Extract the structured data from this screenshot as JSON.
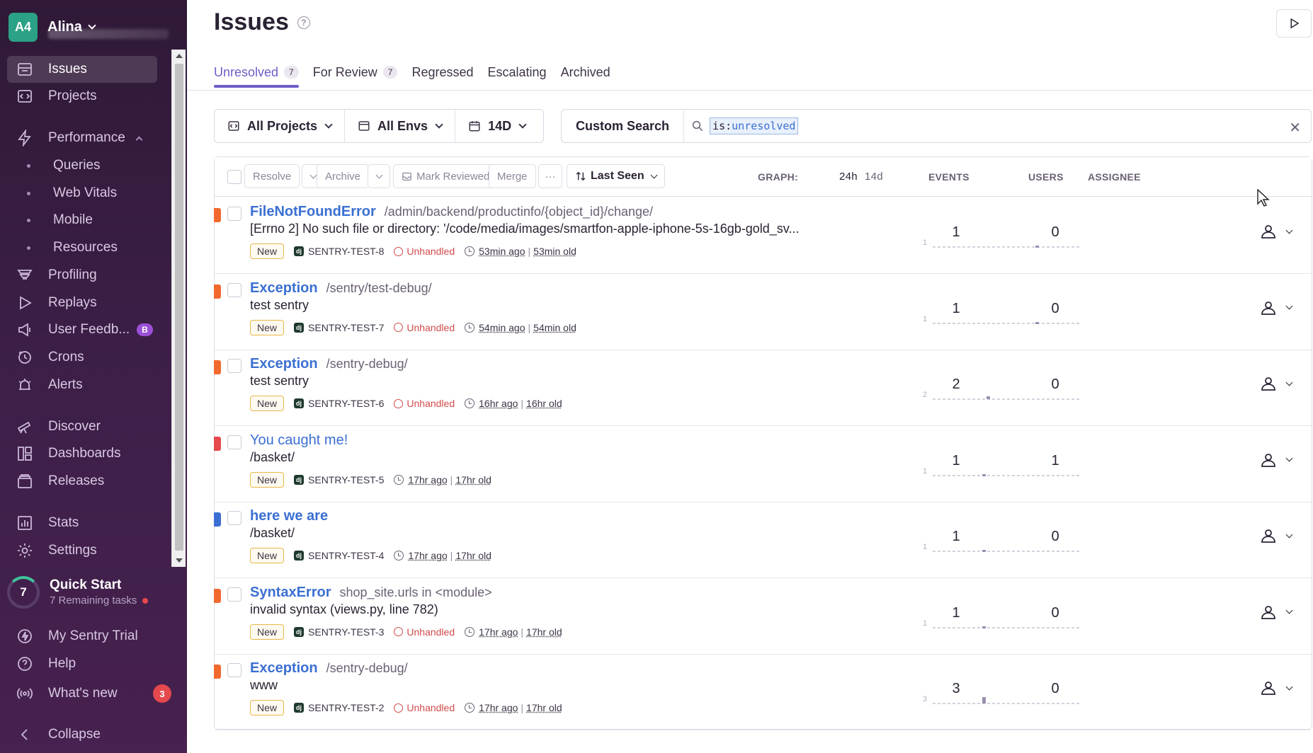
{
  "org": {
    "avatar": "A4",
    "name": "Alina"
  },
  "nav": {
    "issues": "Issues",
    "projects": "Projects",
    "performance": "Performance",
    "queries": "Queries",
    "web_vitals": "Web Vitals",
    "mobile": "Mobile",
    "resources": "Resources",
    "profiling": "Profiling",
    "replays": "Replays",
    "user_feedback": "User Feedb...",
    "user_feedback_badge": "B",
    "crons": "Crons",
    "alerts": "Alerts",
    "discover": "Discover",
    "dashboards": "Dashboards",
    "releases": "Releases",
    "stats": "Stats",
    "settings": "Settings",
    "quick_start": "Quick Start",
    "quick_start_count": "7",
    "quick_start_sub": "7 Remaining tasks",
    "trial": "My Sentry Trial",
    "help": "Help",
    "whats_new": "What's new",
    "whats_new_count": "3",
    "collapse": "Collapse"
  },
  "page": {
    "title": "Issues",
    "help": "?"
  },
  "tabs": [
    {
      "label": "Unresolved",
      "count": "7"
    },
    {
      "label": "For Review",
      "count": "7"
    },
    {
      "label": "Regressed"
    },
    {
      "label": "Escalating"
    },
    {
      "label": "Archived"
    }
  ],
  "filters": {
    "projects": "All Projects",
    "envs": "All Envs",
    "period": "14D"
  },
  "search": {
    "custom": "Custom Search",
    "token_key": "is:",
    "token_val": "unresolved"
  },
  "actions": {
    "resolve": "Resolve",
    "archive": "Archive",
    "mark_reviewed": "Mark Reviewed",
    "merge": "Merge",
    "more": "···",
    "sort": "Last Seen"
  },
  "columns": {
    "graph": "GRAPH:",
    "range_24h": "24h",
    "range_14d": "14d",
    "events": "EVENTS",
    "users": "USERS",
    "assignee": "ASSIGNEE"
  },
  "issues": [
    {
      "title": "FileNotFoundError",
      "location": "/admin/backend/productinfo/{object_id}/change/",
      "message": "[Errno 2] No such file or directory: '/code/media/images/smartfon-apple-iphone-5s-16gb-gold_sv...",
      "badge": "New",
      "short_id": "SENTRY-TEST-8",
      "unhandled": "Unhandled",
      "last_seen": "53min ago",
      "age": "53min old",
      "events": "1",
      "users": "0",
      "graph_max": "1",
      "level_color": "#f2692e"
    },
    {
      "title": "Exception",
      "location": "/sentry/test-debug/",
      "message": "test sentry",
      "badge": "New",
      "short_id": "SENTRY-TEST-7",
      "unhandled": "Unhandled",
      "last_seen": "54min ago",
      "age": "54min old",
      "events": "1",
      "users": "0",
      "graph_max": "1",
      "level_color": "#f2692e"
    },
    {
      "title": "Exception",
      "location": "/sentry-debug/",
      "message": "test sentry",
      "badge": "New",
      "short_id": "SENTRY-TEST-6",
      "unhandled": "Unhandled",
      "last_seen": "16hr ago",
      "age": "16hr old",
      "events": "2",
      "users": "0",
      "graph_max": "2",
      "level_color": "#f2692e"
    },
    {
      "title": "You caught me!",
      "location": "",
      "message": "/basket/",
      "badge": "New",
      "short_id": "SENTRY-TEST-5",
      "unhandled": "",
      "last_seen": "17hr ago",
      "age": "17hr old",
      "events": "1",
      "users": "1",
      "graph_max": "1",
      "level_color": "#e5484d"
    },
    {
      "title": "here we are",
      "location": "",
      "message": "/basket/",
      "badge": "New",
      "short_id": "SENTRY-TEST-4",
      "unhandled": "",
      "last_seen": "17hr ago",
      "age": "17hr old",
      "events": "1",
      "users": "0",
      "graph_max": "1",
      "level_color": "#3b6fd2"
    },
    {
      "title": "SyntaxError",
      "location": "shop_site.urls in <module>",
      "message": "invalid syntax (views.py, line 782)",
      "badge": "New",
      "short_id": "SENTRY-TEST-3",
      "unhandled": "Unhandled",
      "last_seen": "17hr ago",
      "age": "17hr old",
      "events": "1",
      "users": "0",
      "graph_max": "1",
      "level_color": "#f2692e"
    },
    {
      "title": "Exception",
      "location": "/sentry-debug/",
      "message": "www",
      "badge": "New",
      "short_id": "SENTRY-TEST-2",
      "unhandled": "Unhandled",
      "last_seen": "17hr ago",
      "age": "17hr old",
      "events": "3",
      "users": "0",
      "graph_max": "3",
      "level_color": "#f2692e"
    }
  ]
}
